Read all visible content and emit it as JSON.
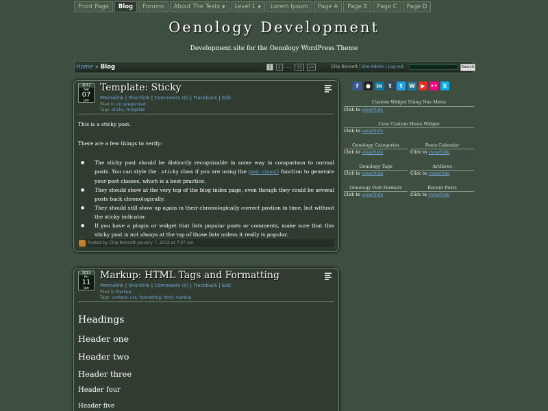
{
  "nav": {
    "tabs": [
      {
        "label": "Front Page",
        "dropdown": false,
        "active": false
      },
      {
        "label": "Blog",
        "dropdown": false,
        "active": true
      },
      {
        "label": "Forums",
        "dropdown": false,
        "active": false
      },
      {
        "label": "About The Tests",
        "dropdown": true,
        "active": false
      },
      {
        "label": "Level 1",
        "dropdown": true,
        "active": false
      },
      {
        "label": "Lorem Ipsum",
        "dropdown": false,
        "active": false
      },
      {
        "label": "Page A",
        "dropdown": false,
        "active": false
      },
      {
        "label": "Page B",
        "dropdown": false,
        "active": false
      },
      {
        "label": "Page C",
        "dropdown": false,
        "active": false
      },
      {
        "label": "Page D",
        "dropdown": false,
        "active": false
      }
    ]
  },
  "header": {
    "title": "Oenology Development",
    "description": "Development site for the Oenology WordPress Theme"
  },
  "breadcrumb": {
    "home": "Home",
    "separator": "»",
    "current": "Blog"
  },
  "pagination": {
    "pages": [
      "1",
      "2",
      "...",
      "11",
      "»»"
    ],
    "current": "1"
  },
  "user": {
    "name": "Chip Bennett",
    "site_admin": "Site Admin",
    "logout": "Log out"
  },
  "search": {
    "value": "",
    "button": "Search"
  },
  "posts": [
    {
      "date": {
        "year": "2012",
        "dow": "Sat",
        "day": "07",
        "month": "Jan"
      },
      "title": "Template: Sticky",
      "links": [
        "Permalink",
        "Shortlink",
        "Comments (0)",
        "Trackback",
        "Edit"
      ],
      "filed_label": "Filed in",
      "category": "Uncategorized",
      "tags_label": "Tags:",
      "tags": [
        "sticky",
        "template"
      ],
      "body": {
        "p1": "This is a sticky post.",
        "p2": "There are a few things to verify:",
        "li1_a": "The sticky post should be distinctly recognizable in some way in comparison to normal posts. You can style the",
        "li1_code": ".sticky",
        "li1_b": "class if you are using the",
        "li1_link": "post_class()",
        "li1_c": "function to generate your post classes, which is a best practice.",
        "li2": "They should show at the very top of the blog index page, even though they could be several posts back chronologically.",
        "li3": "They should still show up again in their chronologically correct postion in time, but without the sticky indicator.",
        "li4": "If you have a plugin or widget that lists popular posts or comments, make sure that this sticky post is not always at the top of those lists unless it really is popular."
      },
      "footer": "Posted by Chip Bennett January 7, 2012 at 7:07 am"
    },
    {
      "date": {
        "year": "2013",
        "dow": "Fri",
        "day": "11",
        "month": "Jan"
      },
      "title": "Markup: HTML Tags and Formatting",
      "links": [
        "Permalink",
        "Shortlink",
        "Comments (0)",
        "Trackback",
        "Edit"
      ],
      "filed_label": "Filed in",
      "category": "Markup",
      "tags_label": "Tags:",
      "tags": [
        "content",
        "css",
        "formatting",
        "html",
        "markup"
      ],
      "headings": [
        "Headings",
        "Header one",
        "Header two",
        "Header three",
        "Header four",
        "Header five"
      ]
    }
  ],
  "sidebar": {
    "social_icons": [
      {
        "name": "facebook-icon",
        "glyph": "f",
        "color": "#3b5998"
      },
      {
        "name": "github-icon",
        "glyph": "●",
        "color": "#222222"
      },
      {
        "name": "linkedin-icon",
        "glyph": "in",
        "color": "#0e76a8"
      },
      {
        "name": "tumblr-icon",
        "glyph": "t",
        "color": "#35465c"
      },
      {
        "name": "twitter-icon",
        "glyph": "t",
        "color": "#1da1f2"
      },
      {
        "name": "wordpress-icon",
        "glyph": "W",
        "color": "#21759b"
      },
      {
        "name": "youtube-icon",
        "glyph": "▶",
        "color": "#e52d27"
      },
      {
        "name": "flickr-icon",
        "glyph": "••",
        "color": "#ff0084"
      },
      {
        "name": "skype-icon",
        "glyph": "S",
        "color": "#00aff0"
      }
    ],
    "click_to": "Click to",
    "toggle_link": "view/hide",
    "widgets": {
      "custom_widget": "Custom Widget Using Nav Menu",
      "core_menu": "Core Custom Menu Widget",
      "categories": "Oenology Categories",
      "calendar": "Posts Calendar",
      "tags": "Oenology Tags",
      "archives": "Archives",
      "formats": "Oenology Post Formats",
      "recent": "Recent Posts"
    }
  }
}
